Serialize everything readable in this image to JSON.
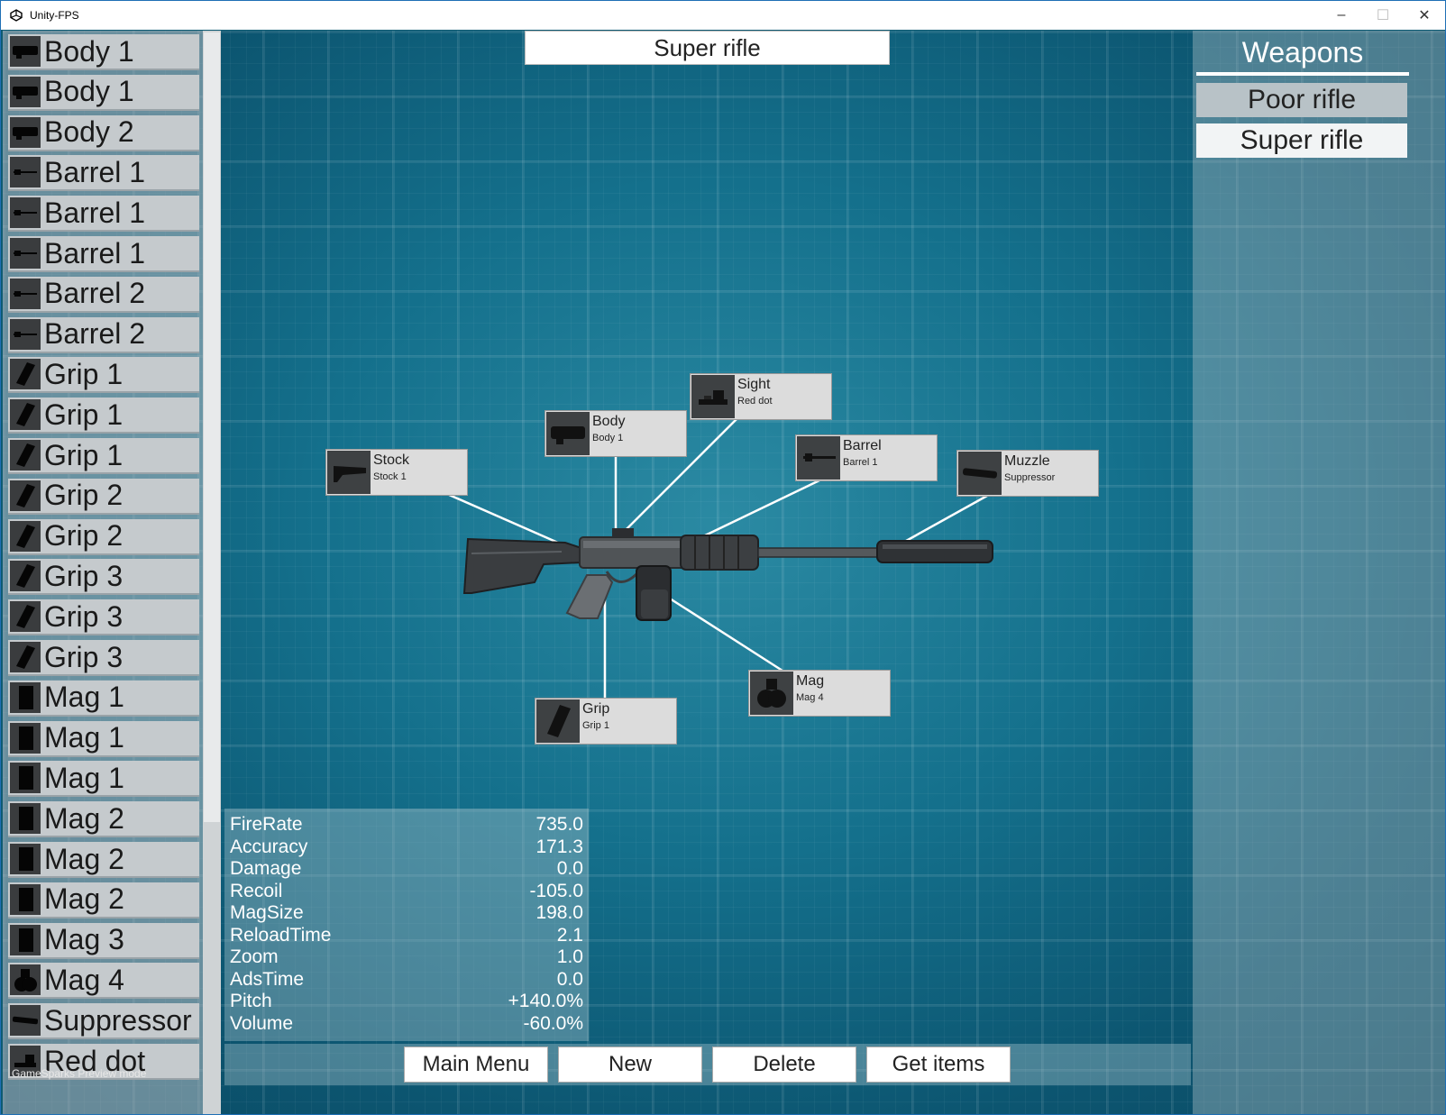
{
  "window": {
    "title": "Unity-FPS"
  },
  "weapon_title": "Super rifle",
  "parts": [
    {
      "label": "Body 1",
      "icon": "body-icon"
    },
    {
      "label": "Body 1",
      "icon": "body-icon"
    },
    {
      "label": "Body 2",
      "icon": "body-icon"
    },
    {
      "label": "Barrel 1",
      "icon": "barrel-icon"
    },
    {
      "label": "Barrel 1",
      "icon": "barrel-icon"
    },
    {
      "label": "Barrel 1",
      "icon": "barrel-icon"
    },
    {
      "label": "Barrel 2",
      "icon": "barrel-icon"
    },
    {
      "label": "Barrel 2",
      "icon": "barrel-icon"
    },
    {
      "label": "Grip 1",
      "icon": "grip-icon"
    },
    {
      "label": "Grip 1",
      "icon": "grip-icon"
    },
    {
      "label": "Grip 1",
      "icon": "grip-icon"
    },
    {
      "label": "Grip 2",
      "icon": "grip-icon"
    },
    {
      "label": "Grip 2",
      "icon": "grip-icon"
    },
    {
      "label": "Grip 3",
      "icon": "grip-icon"
    },
    {
      "label": "Grip 3",
      "icon": "grip-icon"
    },
    {
      "label": "Grip 3",
      "icon": "grip-icon"
    },
    {
      "label": "Mag 1",
      "icon": "mag-icon"
    },
    {
      "label": "Mag 1",
      "icon": "mag-icon"
    },
    {
      "label": "Mag 1",
      "icon": "mag-icon"
    },
    {
      "label": "Mag 2",
      "icon": "mag-icon"
    },
    {
      "label": "Mag 2",
      "icon": "mag-icon"
    },
    {
      "label": "Mag 2",
      "icon": "mag-icon"
    },
    {
      "label": "Mag 3",
      "icon": "mag-icon"
    },
    {
      "label": "Mag 4",
      "icon": "drum-mag-icon"
    },
    {
      "label": "Suppressor",
      "icon": "suppressor-icon"
    },
    {
      "label": "Red dot",
      "icon": "sight-icon"
    }
  ],
  "watermark": "GameSparks Preview mode",
  "slots": {
    "sight": {
      "name": "Sight",
      "value": "Red dot"
    },
    "body": {
      "name": "Body",
      "value": "Body 1"
    },
    "stock": {
      "name": "Stock",
      "value": "Stock 1"
    },
    "barrel": {
      "name": "Barrel",
      "value": "Barrel 1"
    },
    "muzzle": {
      "name": "Muzzle",
      "value": "Suppressor"
    },
    "mag": {
      "name": "Mag",
      "value": "Mag 4"
    },
    "grip": {
      "name": "Grip",
      "value": "Grip 1"
    }
  },
  "stats": [
    {
      "name": "FireRate",
      "value": "735.0"
    },
    {
      "name": "Accuracy",
      "value": "171.3"
    },
    {
      "name": "Damage",
      "value": "0.0"
    },
    {
      "name": "Recoil",
      "value": "-105.0"
    },
    {
      "name": "MagSize",
      "value": "198.0"
    },
    {
      "name": "ReloadTime",
      "value": "2.1"
    },
    {
      "name": "Zoom",
      "value": "1.0"
    },
    {
      "name": "AdsTime",
      "value": "0.0"
    },
    {
      "name": "Pitch",
      "value": "+140.0%"
    },
    {
      "name": "Volume",
      "value": "-60.0%"
    }
  ],
  "weapons_panel": {
    "heading": "Weapons",
    "items": [
      {
        "label": "Poor rifle",
        "selected": false
      },
      {
        "label": "Super rifle",
        "selected": true
      }
    ]
  },
  "bottom_buttons": {
    "main_menu": "Main Menu",
    "new": "New",
    "delete": "Delete",
    "get_items": "Get items"
  },
  "colors": {
    "background": "#0d5a72",
    "panel_selected": "#f2f4f5",
    "panel_item": "#b8c2c7"
  }
}
